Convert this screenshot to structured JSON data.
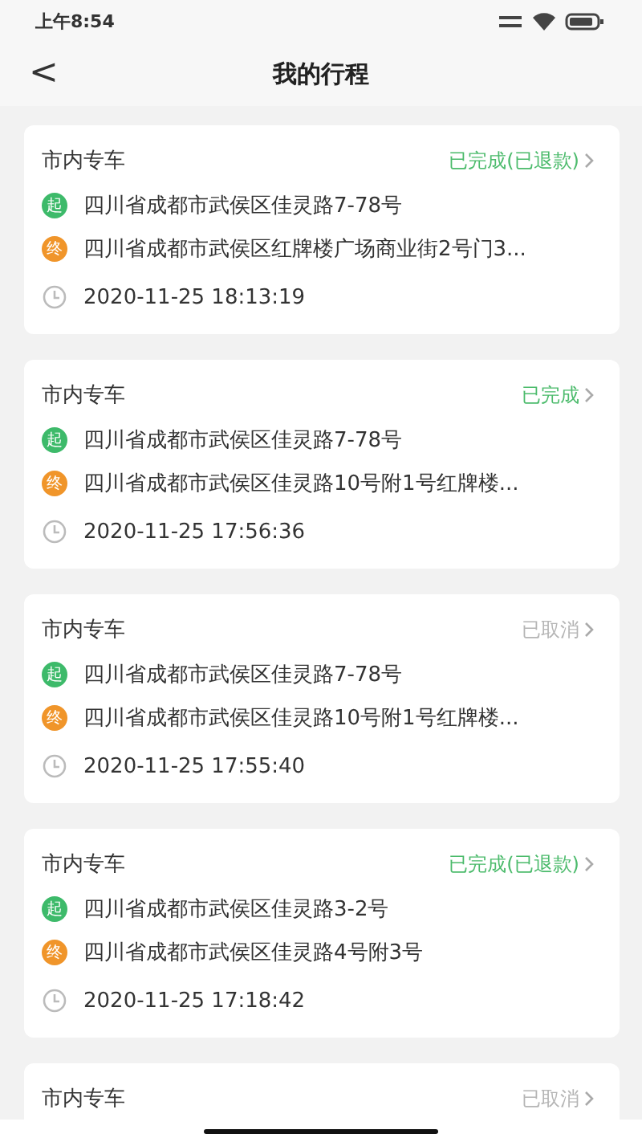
{
  "status_bar": {
    "time": "上午8:54"
  },
  "header": {
    "back": "<",
    "title": "我的行程"
  },
  "trips": [
    {
      "title": "市内专车",
      "status": "已完成(已退款)",
      "kind": "completed",
      "start_mark": "起",
      "start": "四川省成都市武侯区佳灵路7-78号",
      "end_mark": "终",
      "end": "四川省成都市武侯区红牌楼广场商业街2号门3...",
      "time": "2020-11-25 18:13:19"
    },
    {
      "title": "市内专车",
      "status": "已完成",
      "kind": "completed",
      "start_mark": "起",
      "start": "四川省成都市武侯区佳灵路7-78号",
      "end_mark": "终",
      "end": "四川省成都市武侯区佳灵路10号附1号红牌楼...",
      "time": "2020-11-25 17:56:36"
    },
    {
      "title": "市内专车",
      "status": "已取消",
      "kind": "cancelled",
      "start_mark": "起",
      "start": "四川省成都市武侯区佳灵路7-78号",
      "end_mark": "终",
      "end": "四川省成都市武侯区佳灵路10号附1号红牌楼...",
      "time": "2020-11-25 17:55:40"
    },
    {
      "title": "市内专车",
      "status": "已完成(已退款)",
      "kind": "completed",
      "start_mark": "起",
      "start": "四川省成都市武侯区佳灵路3-2号",
      "end_mark": "终",
      "end": "四川省成都市武侯区佳灵路4号附3号",
      "time": "2020-11-25 17:18:42"
    },
    {
      "title": "市内专车",
      "status": "已取消",
      "kind": "cancelled"
    }
  ]
}
